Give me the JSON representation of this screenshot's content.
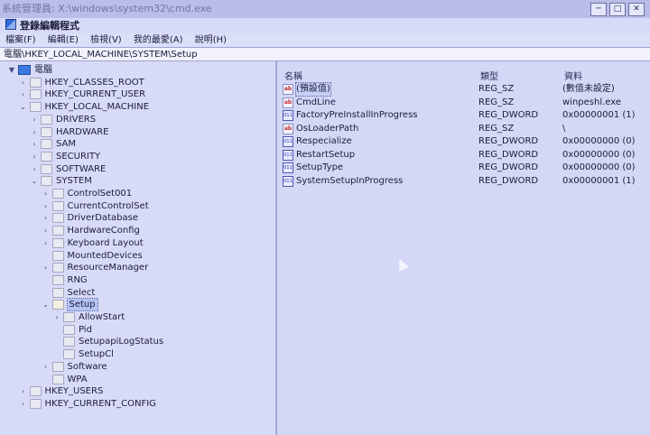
{
  "window": {
    "outer_title": "系統管理員: X:\\windows\\system32\\cmd.exe",
    "app_title": "登錄編輯程式",
    "controls": [
      "─",
      "□",
      "✕"
    ]
  },
  "menu": [
    "檔案(F)",
    "編輯(E)",
    "檢視(V)",
    "我的最愛(A)",
    "說明(H)"
  ],
  "address": "電腦\\HKEY_LOCAL_MACHINE\\SYSTEM\\Setup",
  "tree": [
    {
      "label": "電腦",
      "depth": 0,
      "twisty": "▼",
      "icon": "computer-icon"
    },
    {
      "label": "HKEY_CLASSES_ROOT",
      "depth": 1,
      "twisty": "›",
      "icon": "folder-icon"
    },
    {
      "label": "HKEY_CURRENT_USER",
      "depth": 1,
      "twisty": "›",
      "icon": "folder-icon"
    },
    {
      "label": "HKEY_LOCAL_MACHINE",
      "depth": 1,
      "twisty": "⌄",
      "icon": "folder-icon"
    },
    {
      "label": "DRIVERS",
      "depth": 2,
      "twisty": "›",
      "icon": "folder-icon"
    },
    {
      "label": "HARDWARE",
      "depth": 2,
      "twisty": "›",
      "icon": "folder-icon"
    },
    {
      "label": "SAM",
      "depth": 2,
      "twisty": "›",
      "icon": "folder-icon"
    },
    {
      "label": "SECURITY",
      "depth": 2,
      "twisty": "›",
      "icon": "folder-icon"
    },
    {
      "label": "SOFTWARE",
      "depth": 2,
      "twisty": "›",
      "icon": "folder-icon"
    },
    {
      "label": "SYSTEM",
      "depth": 2,
      "twisty": "⌄",
      "icon": "folder-icon"
    },
    {
      "label": "ControlSet001",
      "depth": 3,
      "twisty": "›",
      "icon": "folder-icon"
    },
    {
      "label": "CurrentControlSet",
      "depth": 3,
      "twisty": "›",
      "icon": "folder-icon"
    },
    {
      "label": "DriverDatabase",
      "depth": 3,
      "twisty": "›",
      "icon": "folder-icon"
    },
    {
      "label": "HardwareConfig",
      "depth": 3,
      "twisty": "›",
      "icon": "folder-icon"
    },
    {
      "label": "Keyboard Layout",
      "depth": 3,
      "twisty": "›",
      "icon": "folder-icon"
    },
    {
      "label": "MountedDevices",
      "depth": 3,
      "twisty": "",
      "icon": "folder-icon"
    },
    {
      "label": "ResourceManager",
      "depth": 3,
      "twisty": "›",
      "icon": "folder-icon"
    },
    {
      "label": "RNG",
      "depth": 3,
      "twisty": "",
      "icon": "folder-icon"
    },
    {
      "label": "Select",
      "depth": 3,
      "twisty": "",
      "icon": "folder-icon"
    },
    {
      "label": "Setup",
      "depth": 3,
      "twisty": "⌄",
      "icon": "folder-icon",
      "selected": true
    },
    {
      "label": "AllowStart",
      "depth": 4,
      "twisty": "›",
      "icon": "folder-icon"
    },
    {
      "label": "Pid",
      "depth": 4,
      "twisty": "",
      "icon": "folder-icon"
    },
    {
      "label": "SetupapiLogStatus",
      "depth": 4,
      "twisty": "",
      "icon": "folder-icon"
    },
    {
      "label": "SetupCl",
      "depth": 4,
      "twisty": "",
      "icon": "folder-icon"
    },
    {
      "label": "Software",
      "depth": 3,
      "twisty": "›",
      "icon": "folder-icon"
    },
    {
      "label": "WPA",
      "depth": 3,
      "twisty": "",
      "icon": "folder-icon"
    },
    {
      "label": "HKEY_USERS",
      "depth": 1,
      "twisty": "›",
      "icon": "folder-icon"
    },
    {
      "label": "HKEY_CURRENT_CONFIG",
      "depth": 1,
      "twisty": "›",
      "icon": "folder-icon"
    }
  ],
  "list": {
    "headers": [
      "名稱",
      "類型",
      "資料"
    ],
    "rows": [
      {
        "name": "(預設值)",
        "type": "REG_SZ",
        "data": "(數值未設定)",
        "icon": "string-value-icon",
        "selected": true
      },
      {
        "name": "CmdLine",
        "type": "REG_SZ",
        "data": "winpeshl.exe",
        "icon": "string-value-icon"
      },
      {
        "name": "FactoryPreInstallInProgress",
        "type": "REG_DWORD",
        "data": "0x00000001 (1)",
        "icon": "binary-value-icon"
      },
      {
        "name": "OsLoaderPath",
        "type": "REG_SZ",
        "data": "\\",
        "icon": "string-value-icon"
      },
      {
        "name": "Respecialize",
        "type": "REG_DWORD",
        "data": "0x00000000 (0)",
        "icon": "binary-value-icon"
      },
      {
        "name": "RestartSetup",
        "type": "REG_DWORD",
        "data": "0x00000000 (0)",
        "icon": "binary-value-icon"
      },
      {
        "name": "SetupType",
        "type": "REG_DWORD",
        "data": "0x00000000 (0)",
        "icon": "binary-value-icon"
      },
      {
        "name": "SystemSetupInProgress",
        "type": "REG_DWORD",
        "data": "0x00000001 (1)",
        "icon": "binary-value-icon"
      }
    ]
  },
  "icon_glyphs": {
    "string": "ab",
    "binary": "011"
  }
}
